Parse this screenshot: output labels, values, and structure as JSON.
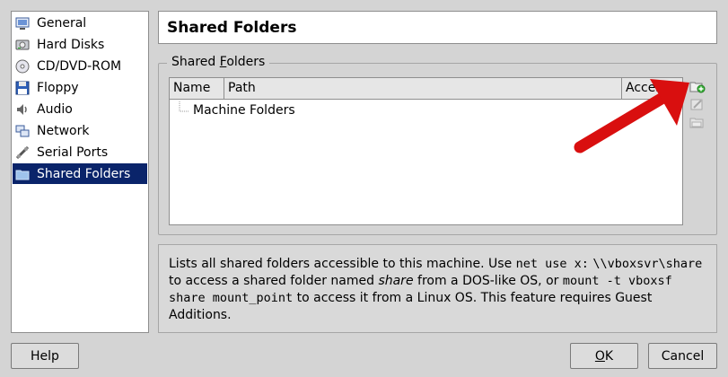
{
  "sidebar": {
    "items": [
      {
        "label": "General",
        "icon": "monitor-icon"
      },
      {
        "label": "Hard Disks",
        "icon": "hard-disk-icon"
      },
      {
        "label": "CD/DVD-ROM",
        "icon": "cd-dvd-icon"
      },
      {
        "label": "Floppy",
        "icon": "floppy-icon"
      },
      {
        "label": "Audio",
        "icon": "audio-icon"
      },
      {
        "label": "Network",
        "icon": "network-icon"
      },
      {
        "label": "Serial Ports",
        "icon": "serial-port-icon"
      },
      {
        "label": "Shared Folders",
        "icon": "shared-folder-icon",
        "selected": true
      }
    ]
  },
  "header": {
    "title": "Shared Folders"
  },
  "group": {
    "title_pre": "Shared ",
    "title_accel": "F",
    "title_post": "olders"
  },
  "table": {
    "columns": [
      "Name",
      "Path",
      "Access"
    ],
    "rows": [
      {
        "label": "Machine Folders"
      }
    ]
  },
  "tools": [
    {
      "name": "add-shared-folder-icon",
      "enabled": true
    },
    {
      "name": "edit-shared-folder-icon",
      "enabled": false
    },
    {
      "name": "remove-shared-folder-icon",
      "enabled": false
    }
  ],
  "description": {
    "p1": "Lists all shared folders accessible to this machine. Use ",
    "c1": "net use x:",
    "c2": "\\\\vboxsvr\\share",
    "p2": " to access a shared folder named ",
    "em1": "share",
    "p3": " from a DOS-like OS, or ",
    "c3": "mount -t vboxsf share mount_point",
    "p4": " to access it from a Linux OS. This feature requires Guest Additions."
  },
  "buttons": {
    "help": "Help",
    "ok_accel": "O",
    "ok_rest": "K",
    "cancel": "Cancel"
  },
  "colors": {
    "selection": "#0a246a",
    "arrow": "#d90f0f"
  }
}
